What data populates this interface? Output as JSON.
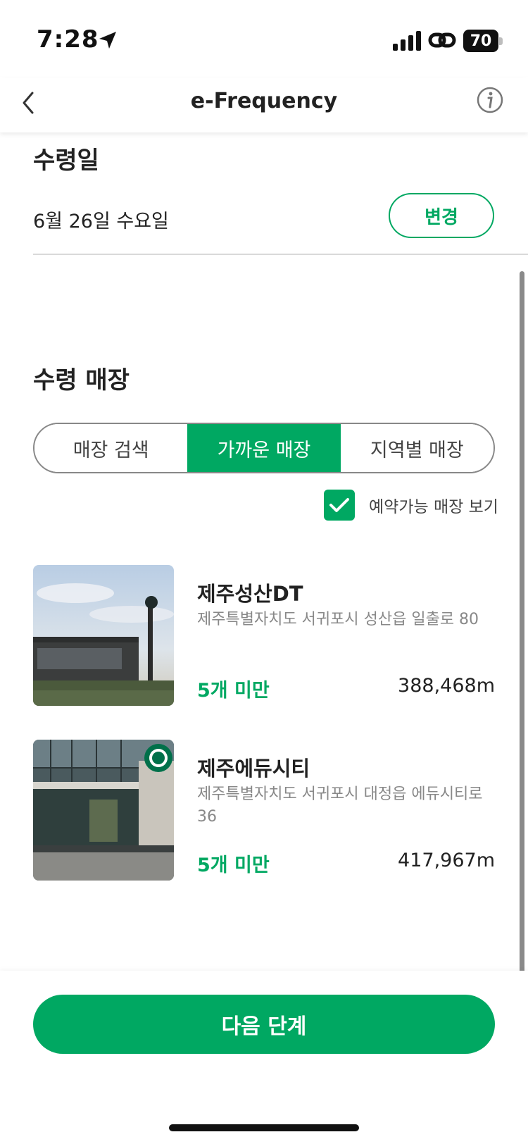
{
  "status_bar": {
    "time": "7:28",
    "battery": "70"
  },
  "header": {
    "title": "e-Frequency",
    "back_icon": "chevron-left-icon",
    "info_icon": "info-icon"
  },
  "pickup_date": {
    "heading": "수령일",
    "date": "6월 26일 수요일",
    "change_label": "변경"
  },
  "pickup_store": {
    "heading": "수령 매장",
    "tabs": [
      {
        "label": "매장 검색",
        "active": false
      },
      {
        "label": "가까운 매장",
        "active": true
      },
      {
        "label": "지역별 매장",
        "active": false
      }
    ],
    "filter_label": "예약가능 매장 보기",
    "filter_checked": true
  },
  "stores": [
    {
      "name": "제주성산DT",
      "address": "제주특별자치도 서귀포시 성산읍 일출로 80",
      "stock": "5개 미만",
      "distance": "388,468m"
    },
    {
      "name": "제주에듀시티",
      "address": "제주특별자치도 서귀포시 대정읍 에듀시티로 36",
      "stock": "5개 미만",
      "distance": "417,967m"
    }
  ],
  "footer": {
    "next_label": "다음 단계"
  },
  "colors": {
    "brand_green": "#00a862",
    "text": "#222222",
    "muted": "#888888"
  }
}
